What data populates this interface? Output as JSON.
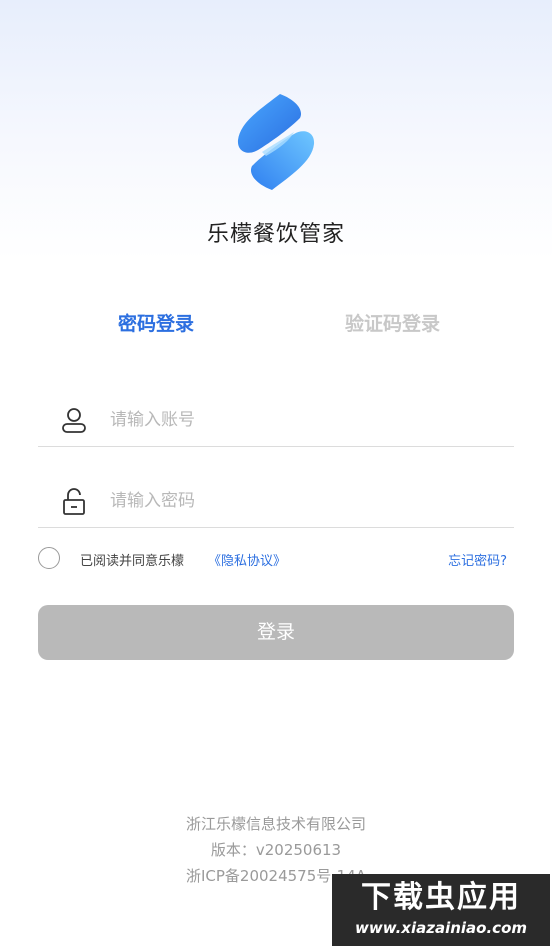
{
  "app": {
    "name": "乐檬餐饮管家"
  },
  "tabs": {
    "password_login": "密码登录",
    "code_login": "验证码登录"
  },
  "form": {
    "account_placeholder": "请输入账号",
    "password_placeholder": "请输入密码",
    "account_icon": "user-icon",
    "password_icon": "lock-icon"
  },
  "agreement": {
    "text": "已阅读并同意乐檬",
    "privacy_link": "《隐私协议》",
    "forgot_password": "忘记密码?"
  },
  "login_button": "登录",
  "footer": {
    "company": "浙江乐檬信息技术有限公司",
    "version": "版本：v20250613",
    "icp": "浙ICP备20024575号-14A"
  },
  "watermark": {
    "title": "下载虫应用",
    "url": "www.xiazainiao.com"
  },
  "colors": {
    "accent": "#2c6fe0",
    "button_disabled": "#b9b9b9",
    "inactive_tab": "#c8c8c8"
  }
}
